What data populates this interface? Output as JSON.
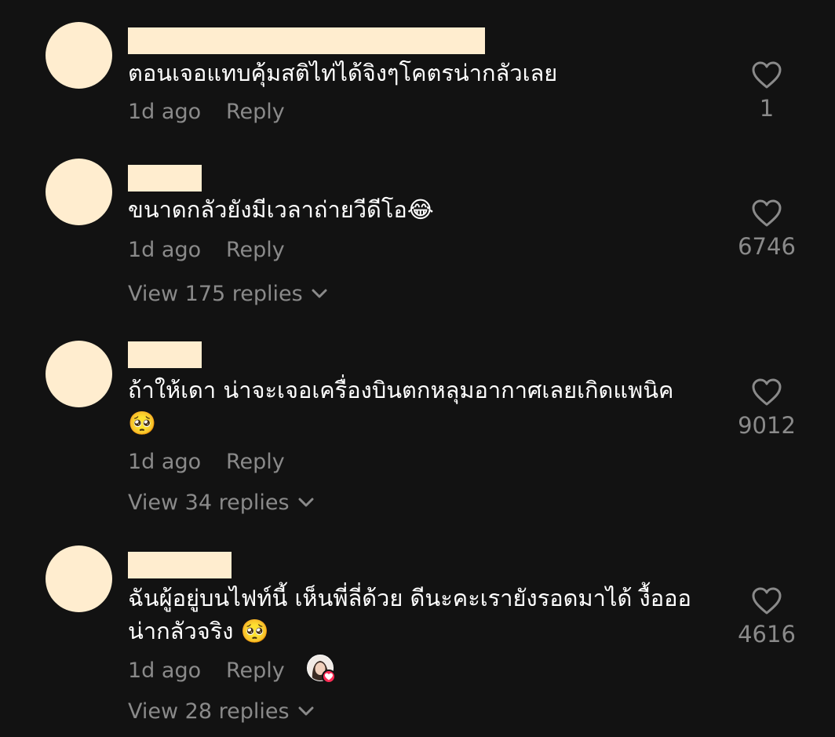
{
  "colors": {
    "background": "#121212",
    "text_primary": "#ffffff",
    "text_secondary": "#8a8a8a",
    "redaction": "#FFEDCF",
    "heart_badge": "#fe2c55"
  },
  "comments": [
    {
      "text": "ตอนเจอแทบคุ้มสติไท่ได้จิงๆโคตรน่ากลัวเลย",
      "time": "1d ago",
      "reply_label": "Reply",
      "like_icon": "heart-outline-icon",
      "likes": "1"
    },
    {
      "text": "ขนาดกลัวยังมีเวลาถ่ายวีดีโอ😂",
      "time": "1d ago",
      "reply_label": "Reply",
      "like_icon": "heart-outline-icon",
      "likes": "6746",
      "view_replies": "View 175 replies"
    },
    {
      "text": "ถ้าให้เดา น่าจะเจอเครื่องบินตกหลุมอากาศเลยเกิดแพนิค\n🥺",
      "time": "1d ago",
      "reply_label": "Reply",
      "like_icon": "heart-outline-icon",
      "likes": "9012",
      "view_replies": "View 34 replies"
    },
    {
      "text": "ฉันผู้อยู่บนไฟท์นี้ เห็นพี่ลี่ด้วย ดีนะคะเรายังรอดมาได้ งื้อออ\nน่ากลัวจริง 🥺",
      "time": "1d ago",
      "reply_label": "Reply",
      "like_icon": "heart-outline-icon",
      "likes": "4616",
      "view_replies": "View 28 replies",
      "creator_liked_icon": "creator-liked-heart-icon"
    }
  ]
}
